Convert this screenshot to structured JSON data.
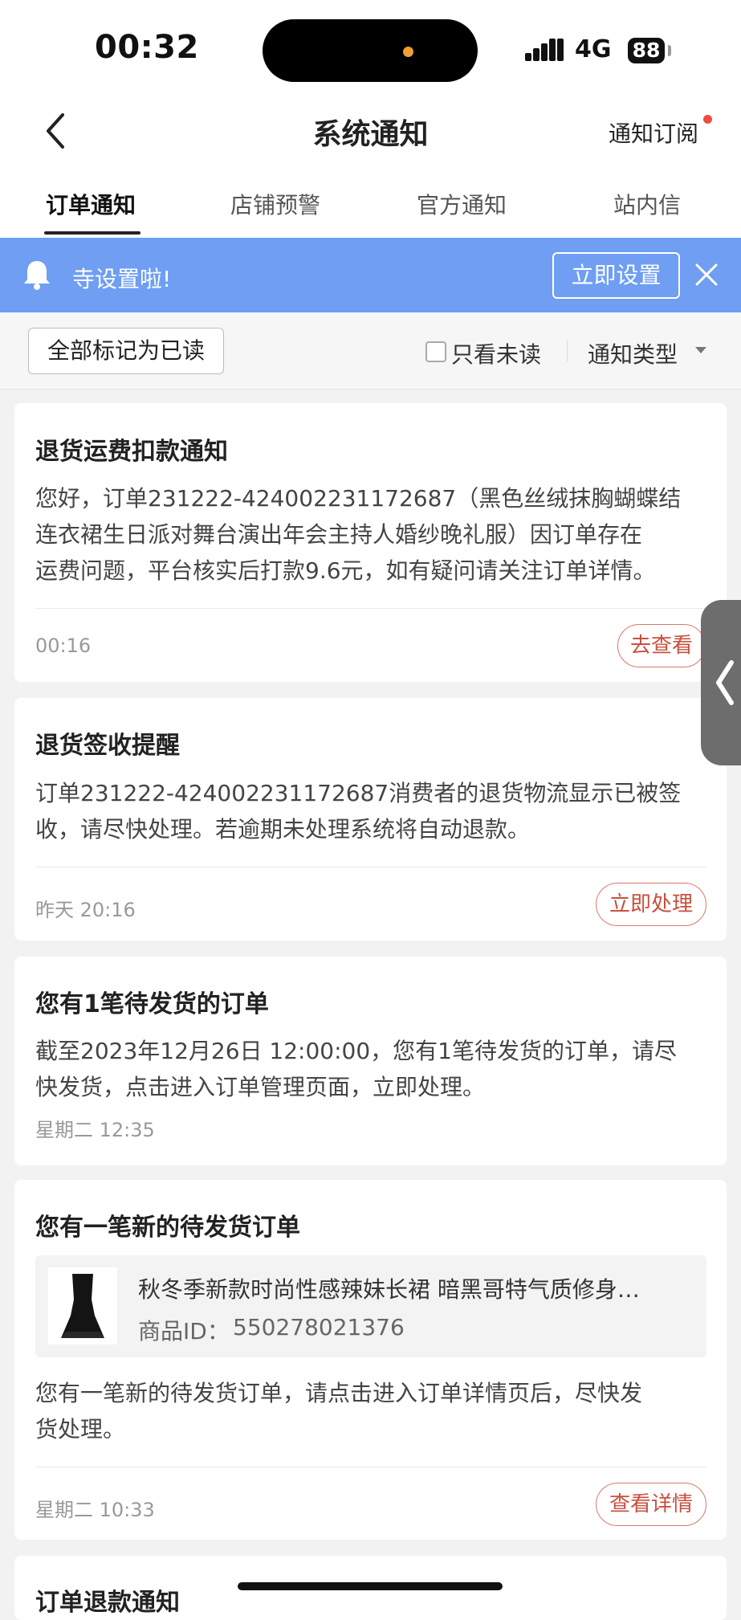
{
  "status_bar": {
    "time": "00:32",
    "network": "4G",
    "battery": "88"
  },
  "header": {
    "title": "系统通知",
    "subscribe_label": "通知订阅"
  },
  "tabs": [
    {
      "label": "订单通知"
    },
    {
      "label": "店铺预警"
    },
    {
      "label": "官方通知"
    },
    {
      "label": "站内信"
    }
  ],
  "banner": {
    "text": "寺设置啦!",
    "button_label": "立即设置"
  },
  "filter_bar": {
    "mark_all_read": "全部标记为已读",
    "unread_only": "只看未读",
    "type_filter": "通知类型"
  },
  "notifications": [
    {
      "title": "退货运费扣款通知",
      "body_lines": [
        "您好，订单231222-424002231172687（黑色丝绒抹胸蝴蝶结",
        "连衣裙生日派对舞台演出年会主持人婚纱晚礼服）因订单存在",
        "运费问题，平台核实后打款9.6元，如有疑问请关注订单详情。"
      ],
      "time": "00:16",
      "action": "去查看"
    },
    {
      "title": "退货签收提醒",
      "body_lines": [
        "订单231222-424002231172687消费者的退货物流显示已被签",
        "收，请尽快处理。若逾期未处理系统将自动退款。"
      ],
      "time": "昨天 20:16",
      "action": "立即处理"
    },
    {
      "title": "您有1笔待发货的订单",
      "body_lines": [
        "截至2023年12月26日 12:00:00，您有1笔待发货的订单，请尽",
        "快发货，点击进入订单管理页面，立即处理。"
      ],
      "time": "星期二 12:35"
    },
    {
      "title": "您有一笔新的待发货订单",
      "product": {
        "name": "秋冬季新款时尚性感辣妹长裙 暗黑哥特气质修身…",
        "id_label": "商品ID：",
        "id": "550278021376"
      },
      "body_lines": [
        "您有一笔新的待发货订单，请点击进入订单详情页后，尽快发",
        "货处理。"
      ],
      "time": "星期二 10:33",
      "action": "查看详情"
    },
    {
      "title": "订单退款通知"
    }
  ]
}
